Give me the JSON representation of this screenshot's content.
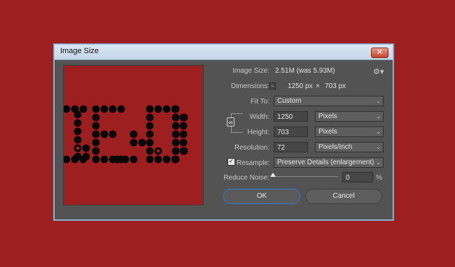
{
  "dialog": {
    "title": "Image Size",
    "close_label": "✕"
  },
  "image_size": {
    "label": "Image Size:",
    "value": "2.51M (was 5.93M)"
  },
  "dimensions": {
    "label": "Dimensions:",
    "width": "1250 px",
    "times": "×",
    "height": "703 px"
  },
  "fit_to": {
    "label": "Fit To:",
    "value": "Custom"
  },
  "width": {
    "label": "Width:",
    "value": "1250",
    "unit": "Pixels"
  },
  "height": {
    "label": "Height:",
    "value": "703",
    "unit": "Pixels"
  },
  "resolution": {
    "label": "Resolution:",
    "value": "72",
    "unit": "Pixels/Inch"
  },
  "resample": {
    "label": "Resample:",
    "checked": true,
    "value": "Preserve Details (enlargement)"
  },
  "reduce_noise": {
    "label": "Reduce Noise:",
    "value": "0",
    "unit": "%"
  },
  "buttons": {
    "ok": "OK",
    "cancel": "Cancel"
  },
  "icons": {
    "gear": "gear-icon",
    "chain": "chain-link-icon",
    "dropdown": "chevron-down-icon",
    "close": "close-icon",
    "dimensions": "dimensions-dropdown-icon"
  },
  "colors": {
    "background": "#9e1f1f",
    "dialog": "#535353",
    "ok_border": "#2c7fd0"
  }
}
